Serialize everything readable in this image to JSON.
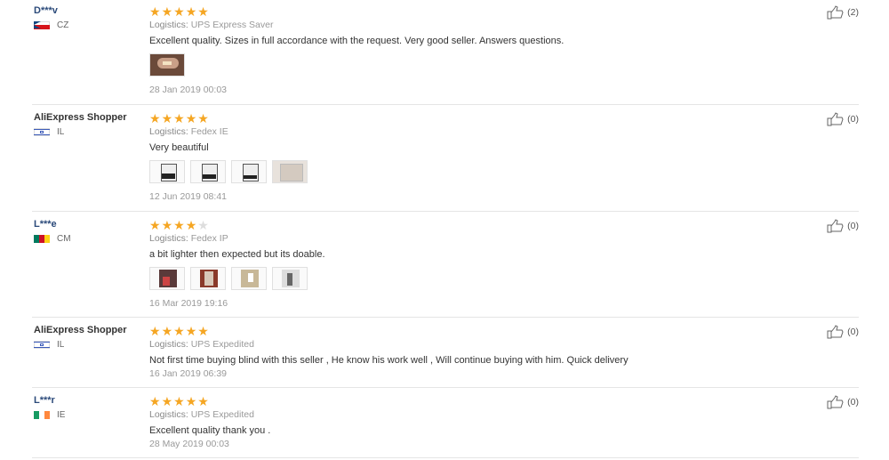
{
  "reviews": [
    {
      "user": "D***v",
      "country": "CZ",
      "stars": 5,
      "logistics_label": "Logistics:",
      "logistics": "UPS Express Saver",
      "text": "Excellent quality. Sizes in full accordance with the request. Very good seller. Answers questions.",
      "date": "28 Jan 2019 00:03",
      "helpful": "(2)",
      "photos": 1
    },
    {
      "user": "AliExpress Shopper",
      "country": "IL",
      "stars": 5,
      "logistics_label": "Logistics:",
      "logistics": "Fedex IE",
      "text": "Very beautiful",
      "date": "12 Jun 2019 08:41",
      "helpful": "(0)",
      "photos": 4
    },
    {
      "user": "L***e",
      "country": "CM",
      "stars": 4,
      "logistics_label": "Logistics:",
      "logistics": "Fedex IP",
      "text": "a bit lighter then expected but its doable.",
      "date": "16 Mar 2019 19:16",
      "helpful": "(0)",
      "photos": 4
    },
    {
      "user": "AliExpress Shopper",
      "country": "IL",
      "stars": 5,
      "logistics_label": "Logistics:",
      "logistics": "UPS Expedited",
      "text": "Not first time buying blind with this seller , He know his work well , Will continue buying with him. Quick delivery",
      "date": "16 Jan 2019 06:39",
      "helpful": "(0)",
      "photos": 0
    },
    {
      "user": "L***r",
      "country": "IE",
      "stars": 5,
      "logistics_label": "Logistics:",
      "logistics": "UPS Expedited",
      "text": "Excellent quality thank you .",
      "date": "28 May 2019 00:03",
      "helpful": "(0)",
      "photos": 0
    }
  ],
  "colors": {
    "star": "#f5a623",
    "star_off": "#dddddd",
    "masked_name": "#2b4a7a"
  }
}
